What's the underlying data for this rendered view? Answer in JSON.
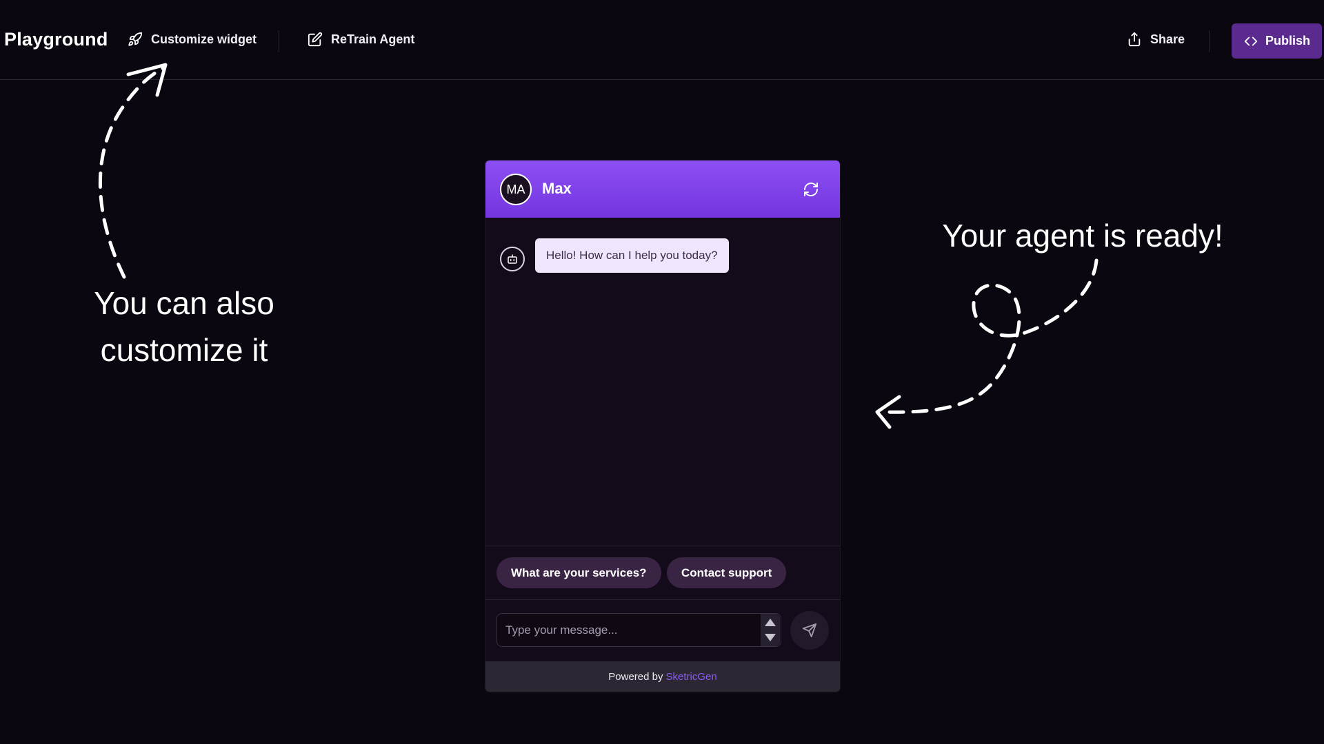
{
  "header": {
    "title": "Playground",
    "customize_label": "Customize widget",
    "retrain_label": "ReTrain Agent",
    "share_label": "Share",
    "publish_label": "Publish"
  },
  "annotations": {
    "left_line1": "You can also",
    "left_line2": "customize it",
    "right": "Your agent is ready!"
  },
  "widget": {
    "avatar_initials": "MA",
    "agent_name": "Max",
    "greeting": "Hello! How can I help you today?",
    "suggestions": [
      "What are your services?",
      "Contact support"
    ],
    "input_placeholder": "Type your message...",
    "footer_prefix": "Powered by",
    "footer_brand": "SketricGen"
  },
  "colors": {
    "header_gradient_top": "#8c4ff2",
    "publish_bg": "#5b2a8e",
    "brand_link": "#8a5cf6"
  },
  "icons": [
    "rocket-icon",
    "edit-icon",
    "share-icon",
    "code-icon",
    "refresh-icon",
    "bot-icon",
    "send-icon"
  ]
}
